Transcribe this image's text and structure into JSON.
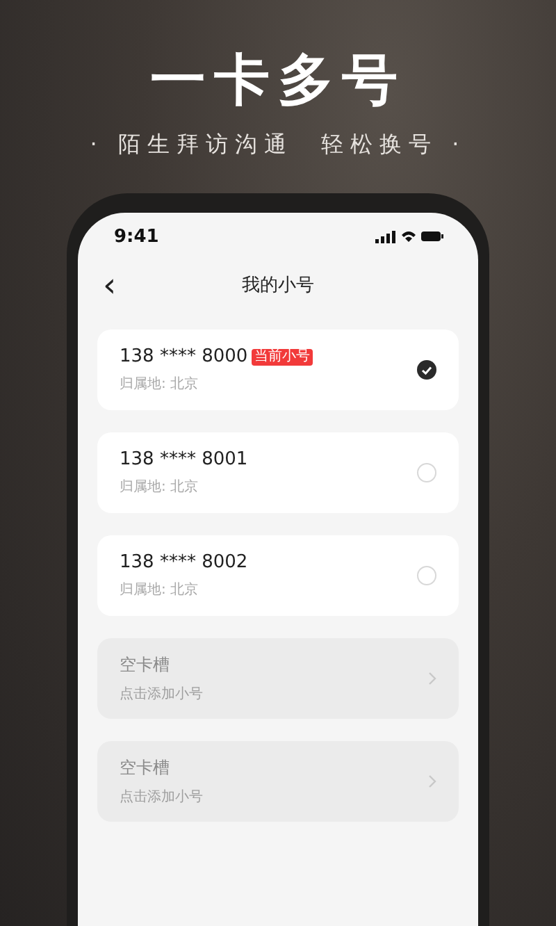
{
  "headline": "一卡多号",
  "tagline": "· 陌生拜访沟通  轻松换号 ·",
  "phone": {
    "status_bar": {
      "time": "9:41"
    },
    "nav": {
      "back": "‹",
      "title": "我的小号"
    },
    "slots": [
      {
        "kind": "number",
        "number": "138 **** 8000",
        "badge": "当前小号",
        "location": "归属地: 北京",
        "selected": true
      },
      {
        "kind": "number",
        "number": "138 **** 8001",
        "location": "归属地: 北京",
        "selected": false
      },
      {
        "kind": "number",
        "number": "138 **** 8002",
        "location": "归属地: 北京",
        "selected": false
      },
      {
        "kind": "empty",
        "title": "空卡槽",
        "hint": "点击添加小号"
      },
      {
        "kind": "empty",
        "title": "空卡槽",
        "hint": "点击添加小号"
      }
    ]
  }
}
